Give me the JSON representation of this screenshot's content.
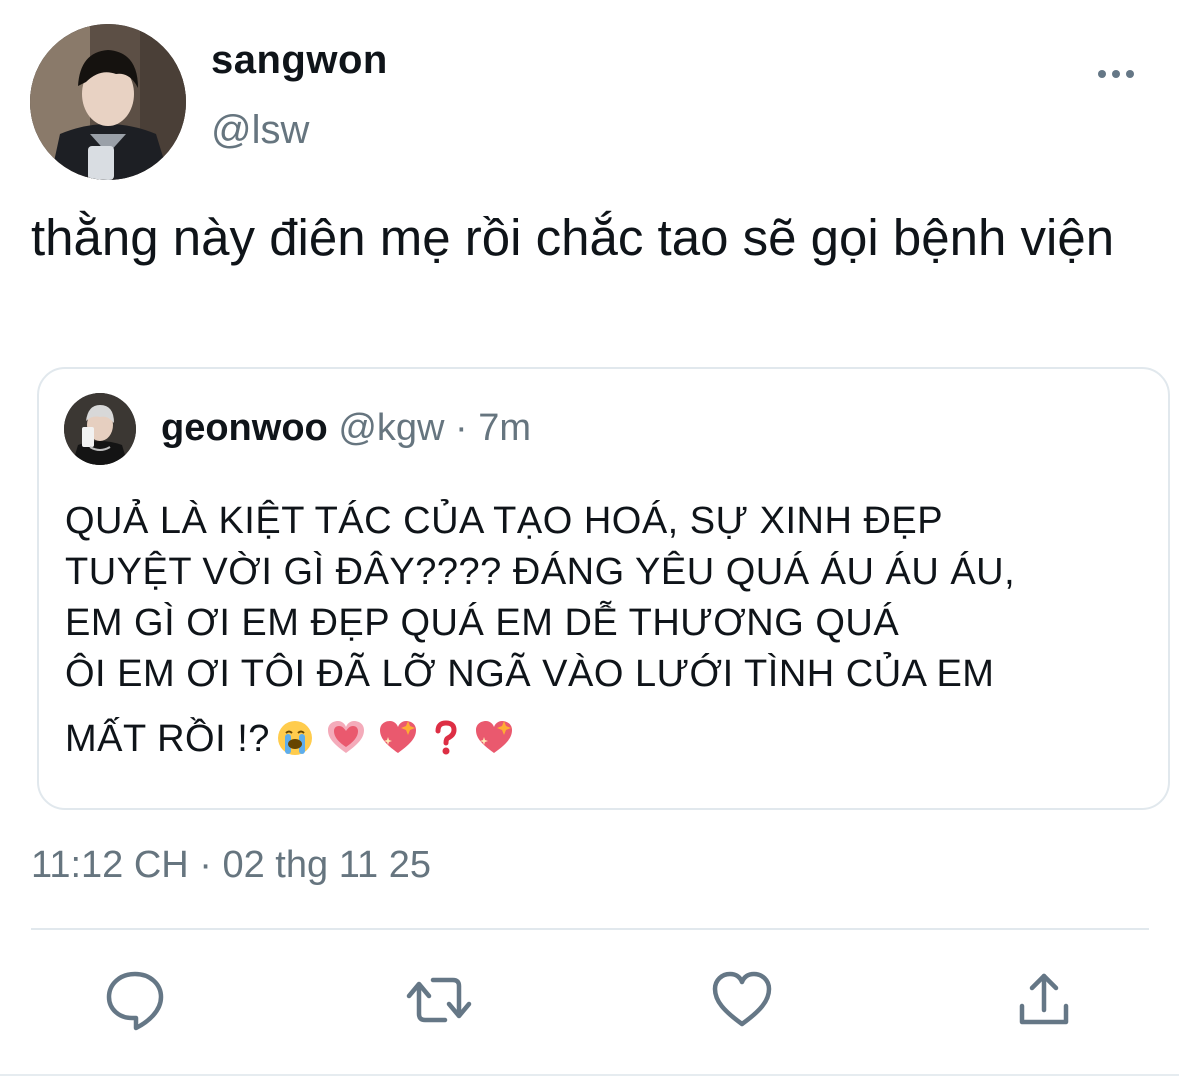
{
  "tweet": {
    "author": {
      "display_name": "sangwon",
      "handle": "@lsw"
    },
    "text": "thằng này điên mẹ rồi chắc tao sẽ gọi bệnh viện",
    "timestamp": "11:12 CH · 02 thg 11 25"
  },
  "quoted_tweet": {
    "author": {
      "display_name": "geonwoo",
      "handle": "@kgw",
      "separator": " · ",
      "time_ago": "7m"
    },
    "lines": [
      "QUẢ LÀ KIỆT TÁC CỦA TẠO HOÁ, SỰ XINH ĐẸP",
      "TUYỆT VỜI GÌ ĐÂY???? ĐÁNG YÊU QUÁ ÁU ÁU ÁU,",
      "EM GÌ ƠI EM ĐẸP QUÁ EM DỄ THƯƠNG QUÁ",
      "ÔI EM ƠI TÔI ĐÃ LỠ NGÃ VÀO LƯỚI TÌNH CỦA EM",
      "MẤT RỒI !?"
    ],
    "emojis": [
      "crying-face",
      "pink-heart",
      "sparkling-heart",
      "red-question-mark",
      "sparkling-heart"
    ]
  },
  "actions": [
    "reply-icon",
    "retweet-icon",
    "like-icon",
    "share-icon"
  ],
  "colors": {
    "text": "#0f1419",
    "secondary": "#66757f",
    "border": "#e1e8ed",
    "icon": "#657786"
  }
}
